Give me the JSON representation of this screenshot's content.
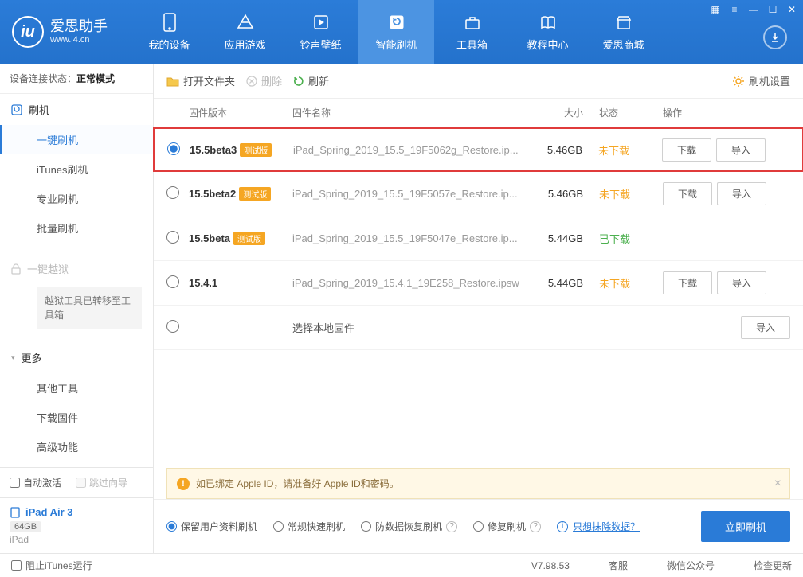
{
  "app": {
    "name": "爱思助手",
    "site": "www.i4.cn"
  },
  "nav": {
    "items": [
      {
        "label": "我的设备"
      },
      {
        "label": "应用游戏"
      },
      {
        "label": "铃声壁纸"
      },
      {
        "label": "智能刷机"
      },
      {
        "label": "工具箱"
      },
      {
        "label": "教程中心"
      },
      {
        "label": "爱思商城"
      }
    ],
    "activeIndex": 3
  },
  "sidebar": {
    "conn_label": "设备连接状态：",
    "conn_value": "正常模式",
    "flash_head": "刷机",
    "items": {
      "onekey": "一键刷机",
      "itunes": "iTunes刷机",
      "pro": "专业刷机",
      "batch": "批量刷机"
    },
    "jailbreak_head": "一键越狱",
    "jailbreak_note": "越狱工具已转移至工具箱",
    "more_head": "更多",
    "more": {
      "other": "其他工具",
      "download": "下载固件",
      "advanced": "高级功能"
    },
    "auto_activate": "自动激活",
    "skip_guide": "跳过向导",
    "device": {
      "name": "iPad Air 3",
      "capacity": "64GB",
      "type": "iPad"
    }
  },
  "toolbar": {
    "open": "打开文件夹",
    "delete": "删除",
    "refresh": "刷新",
    "settings": "刷机设置"
  },
  "columns": {
    "version": "固件版本",
    "name": "固件名称",
    "size": "大小",
    "status": "状态",
    "action": "操作"
  },
  "beta_tag": "测试版",
  "buttons": {
    "download": "下载",
    "import": "导入"
  },
  "firmware": [
    {
      "version": "15.5beta3",
      "beta": true,
      "name": "iPad_Spring_2019_15.5_19F5062g_Restore.ip...",
      "size": "5.46GB",
      "status": "未下载",
      "status_class": "not",
      "dl": true,
      "selected": true,
      "highlight": true
    },
    {
      "version": "15.5beta2",
      "beta": true,
      "name": "iPad_Spring_2019_15.5_19F5057e_Restore.ip...",
      "size": "5.46GB",
      "status": "未下载",
      "status_class": "not",
      "dl": true
    },
    {
      "version": "15.5beta",
      "beta": true,
      "name": "iPad_Spring_2019_15.5_19F5047e_Restore.ip...",
      "size": "5.44GB",
      "status": "已下载",
      "status_class": "done",
      "dl": false
    },
    {
      "version": "15.4.1",
      "beta": false,
      "name": "iPad_Spring_2019_15.4.1_19E258_Restore.ipsw",
      "size": "5.44GB",
      "status": "未下载",
      "status_class": "not",
      "dl": true
    }
  ],
  "local_row": "选择本地固件",
  "notice": "如已绑定 Apple ID，请准备好 Apple ID和密码。",
  "flash_opts": {
    "keep": "保留用户资料刷机",
    "normal": "常规快速刷机",
    "recover": "防数据恢复刷机",
    "repair": "修复刷机",
    "erase": "只想抹除数据？",
    "go": "立即刷机"
  },
  "footer": {
    "block_itunes": "阻止iTunes运行",
    "version": "V7.98.53",
    "support": "客服",
    "wechat": "微信公众号",
    "update": "检查更新"
  }
}
